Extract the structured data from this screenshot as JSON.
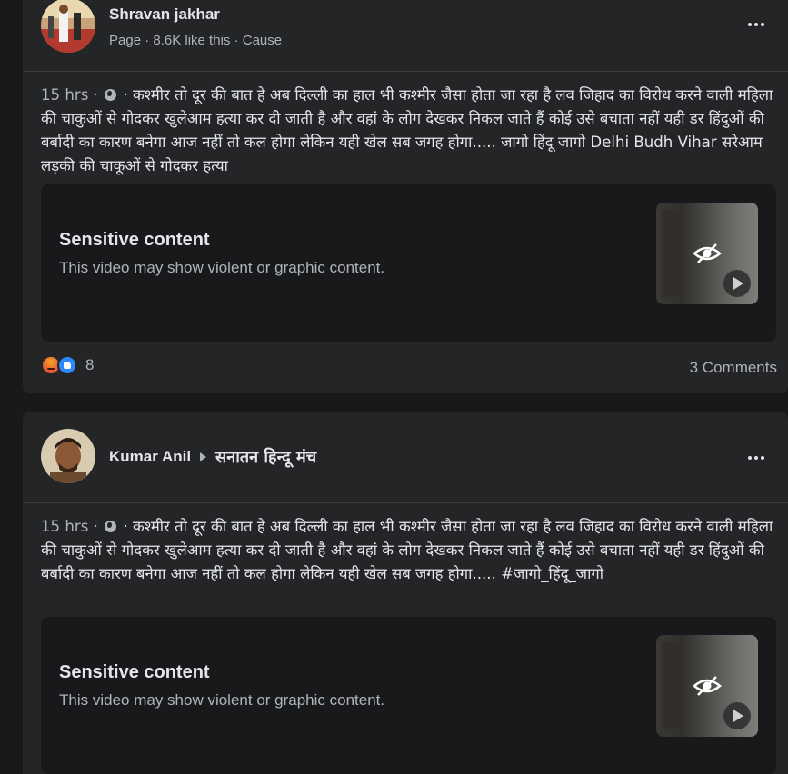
{
  "posts": [
    {
      "author": "Shravan jakhar",
      "meta": "Page · 8.6K like this · Cause",
      "time": "15 hrs ·",
      "text": " · कश्मीर तो दूर की बात हे अब दिल्ली का हाल भी कश्मीर जैसा होता जा रहा है लव जिहाद का विरोध करने वाली महिला की चाकुओं से गोदकर खुलेआम हत्या कर दी जाती है और वहां के लोग देखकर निकल जाते हैं कोई उसे बचाता नहीं यही डर हिंदुओं की बर्बादी का कारण बनेगा आज नहीं तो कल होगा लेकिन यही खेल सब जगह होगा..... जागो हिंदू जागो Delhi Budh Vihar सरेआम लड़की की चाकूओं से गोदकर हत्या",
      "sensitive_title": "Sensitive content",
      "sensitive_desc": "This video may show violent or graphic content.",
      "reaction_count": "8",
      "comments": "3 Comments"
    },
    {
      "author": "Kumar Anil",
      "group": "सनातन हिन्दू मंच",
      "time": "15 hrs ·",
      "text": " · कश्मीर तो दूर की बात हे अब दिल्ली का हाल भी कश्मीर जैसा होता जा रहा है लव जिहाद का विरोध करने वाली महिला की चाकुओं से गोदकर खुलेआम हत्या कर दी जाती है और वहां के लोग देखकर निकल जाते हैं कोई उसे बचाता नहीं यही डर हिंदुओं की बर्बादी का कारण बनेगा आज नहीं तो कल होगा लेकिन यही खेल सब जगह होगा..... #जागो_हिंदू_जागो",
      "sensitive_title": "Sensitive content",
      "sensitive_desc": "This video may show violent or graphic content."
    }
  ],
  "icons": [
    "avatar",
    "more-options-icon",
    "globe-icon",
    "hidden-eye-icon",
    "play-icon",
    "angry-reaction-icon",
    "like-reaction-icon",
    "arrow-right-icon"
  ],
  "colors": {
    "background": "#18191a",
    "card": "#242526",
    "text": "#e4e6eb",
    "secondary_text": "#b0b3b8"
  }
}
